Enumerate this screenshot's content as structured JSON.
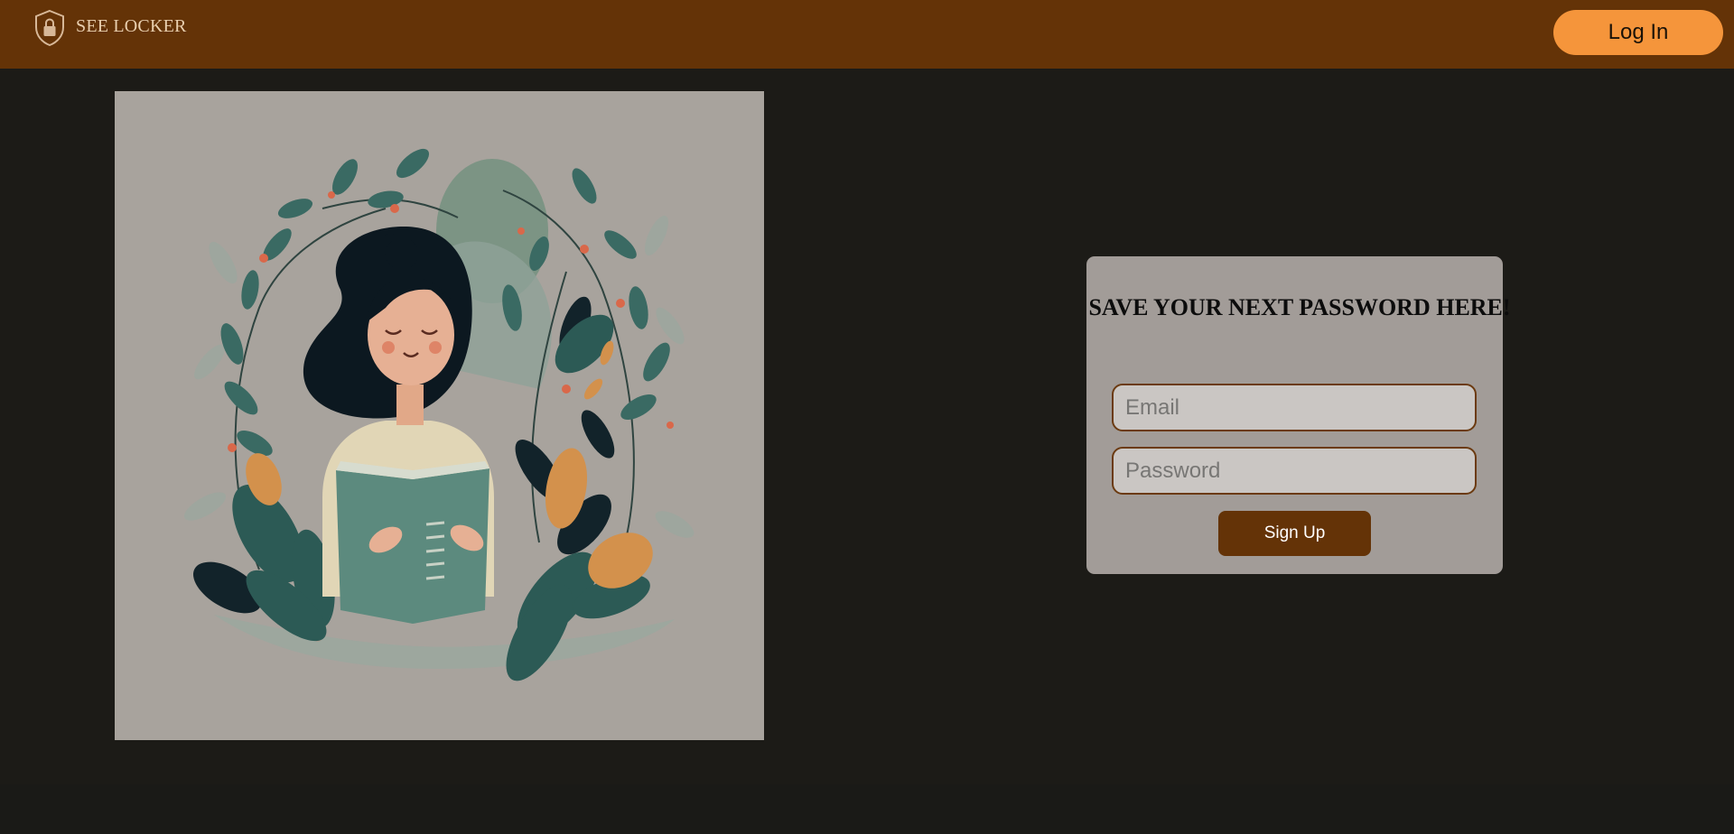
{
  "header": {
    "brand_name": "SEE LOCKER",
    "brand_icon": "shield-lock-icon",
    "login_label": "Log In"
  },
  "illustration": {
    "subject": "woman-reading-book-with-leaves"
  },
  "signup_form": {
    "title": "SAVE YOUR NEXT PASSWORD HERE!",
    "email_placeholder": "Email",
    "email_value": "",
    "password_placeholder": "Password",
    "password_value": "",
    "submit_label": "Sign Up"
  },
  "colors": {
    "header_bg": "#643307",
    "accent": "#f5953b",
    "page_bg": "#1c1b17",
    "card_bg": "#a29c98",
    "button_bg": "#643307"
  }
}
